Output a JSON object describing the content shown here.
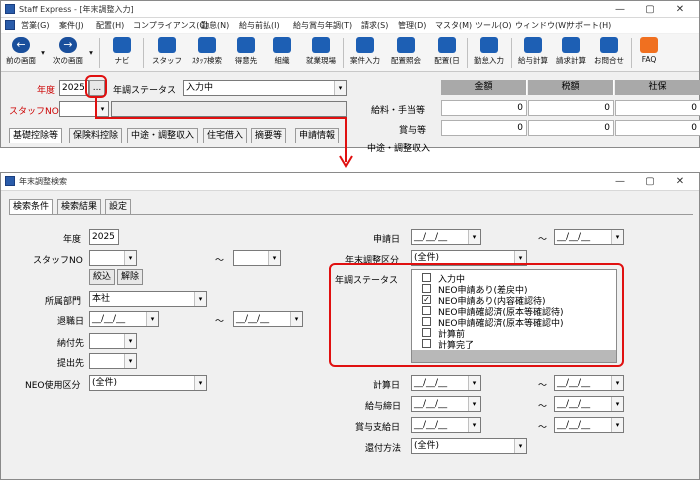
{
  "top_window": {
    "title": "Staff Express - [年末調整入力]",
    "menu": [
      "営業(G)",
      "案件(J)",
      "配置(H)",
      "コンプライアンス(C)",
      "勤怠(N)",
      "給与前払(I)",
      "給与賞与年調(T)",
      "請求(S)",
      "管理(D)",
      "マスタ(M)",
      "ツール(O)",
      "ウィンドウ(W)",
      "サポート(H)"
    ],
    "toolbar": [
      "前の画面",
      "次の画面",
      "ナビ",
      "スタッフ",
      "ｽﾀｯﾌ検索",
      "得意先",
      "組織",
      "就業現場",
      "案件入力",
      "配置照会",
      "配置(日",
      "勤怠入力",
      "給与計算",
      "請求計算",
      "お問合せ",
      "FAQ"
    ],
    "year_label": "年度",
    "year_value": "2025",
    "ellipsis_label": "...",
    "status_label": "年調ステータス",
    "status_value": "入力中",
    "staff_label": "スタッフNO",
    "tabs": [
      "基礎控除等",
      "保険料控除",
      "中途・調整収入",
      "住宅借入",
      "摘要等",
      "申請情報"
    ],
    "grid_headers": [
      "金額",
      "税額",
      "社保"
    ],
    "grid_rows": [
      {
        "label": "給料・手当等",
        "values": [
          "0",
          "0",
          "0"
        ]
      },
      {
        "label": "賞与等",
        "values": [
          "0",
          "0",
          "0"
        ]
      },
      {
        "label": "中途・調整収入",
        "values": []
      }
    ]
  },
  "search_window": {
    "title": "年末調整検索",
    "tabs": [
      "検索条件",
      "検索結果",
      "設定"
    ],
    "year_label": "年度",
    "year_value": "2025",
    "staff_label": "スタッフNO",
    "range_sep": "～",
    "narrow_button": "絞込",
    "clear_button": "解除",
    "dept_label": "所属部門",
    "dept_value": "本社",
    "retire_label": "退職日",
    "date_placeholder": "__/__/__",
    "payee_label": "納付先",
    "submit_label": "提出先",
    "neo_label": "NEO使用区分",
    "neo_value": "(全件)",
    "apply_date_label": "申請日",
    "nencho_kubun_label": "年末調整区分",
    "nencho_kubun_value": "(全件)",
    "status_label": "年調ステータス",
    "status_options": [
      {
        "label": "入力中",
        "checked": false
      },
      {
        "label": "NEO申請あり(差戻中)",
        "checked": false
      },
      {
        "label": "NEO申請あり(内容確認待)",
        "checked": true
      },
      {
        "label": "NEO申請確認済(原本等確認待)",
        "checked": false
      },
      {
        "label": "NEO申請確認済(原本等確認中)",
        "checked": false
      },
      {
        "label": "計算前",
        "checked": false
      },
      {
        "label": "計算完了",
        "checked": false
      }
    ],
    "calc_date_label": "計算日",
    "pay_close_label": "給与締日",
    "bonus_pay_label": "賞与支給日",
    "refund_label": "還付方法",
    "refund_value": "(全件)"
  }
}
